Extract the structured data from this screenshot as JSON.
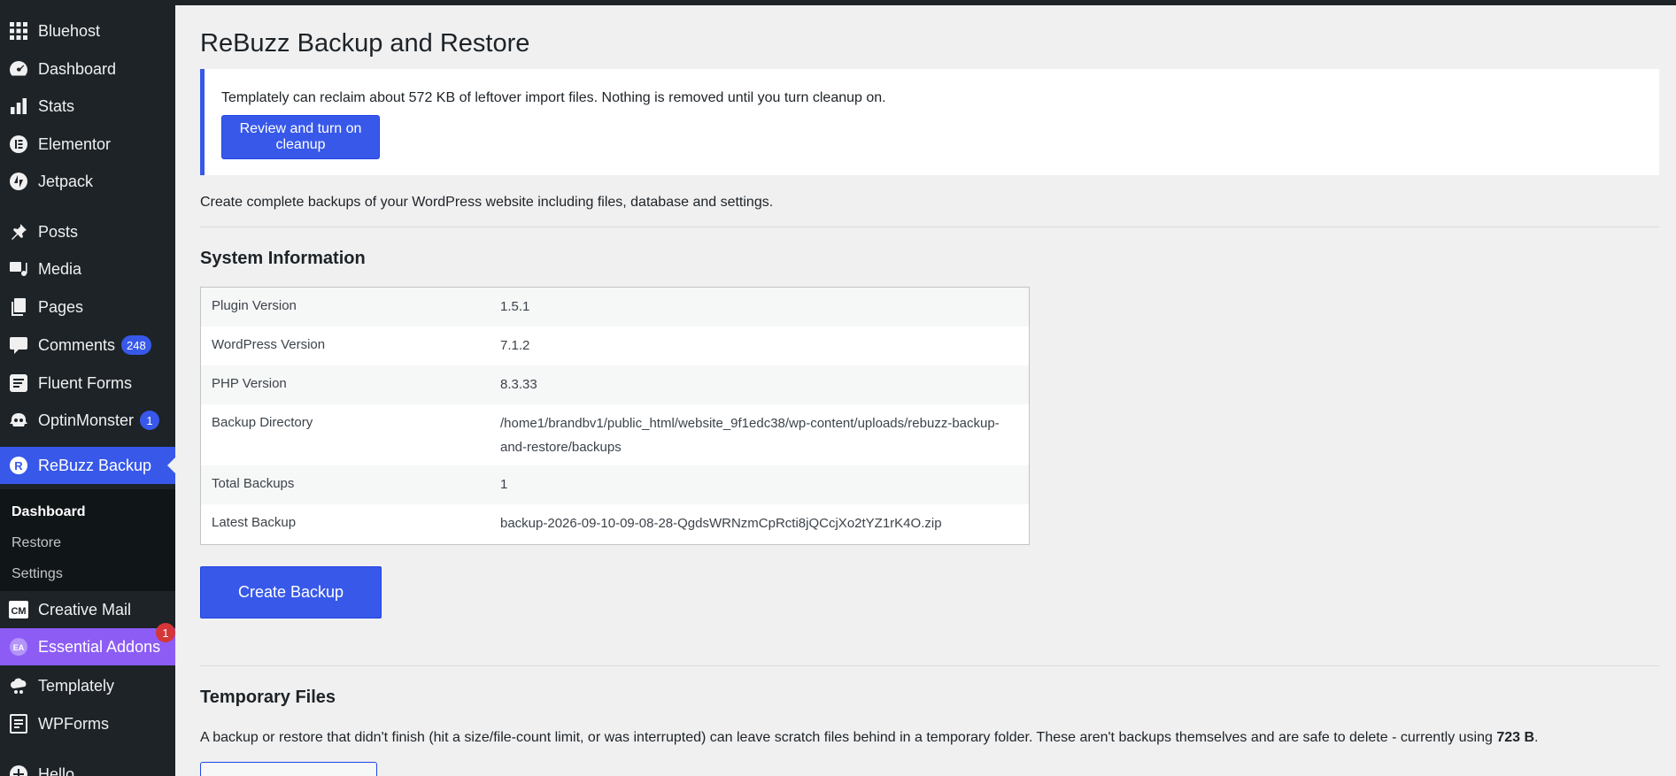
{
  "sidebar": {
    "items": [
      {
        "label": "Bluehost",
        "icon": "grid-icon"
      },
      {
        "label": "Dashboard",
        "icon": "dashboard-icon"
      },
      {
        "label": "Stats",
        "icon": "stats-icon"
      },
      {
        "label": "Elementor",
        "icon": "elementor-icon"
      },
      {
        "label": "Jetpack",
        "icon": "jetpack-icon"
      },
      {
        "label": "Posts",
        "icon": "pin-icon"
      },
      {
        "label": "Media",
        "icon": "media-icon"
      },
      {
        "label": "Pages",
        "icon": "pages-icon"
      },
      {
        "label": "Comments",
        "icon": "comment-icon",
        "badge": "248"
      },
      {
        "label": "Fluent Forms",
        "icon": "forms-icon"
      },
      {
        "label": "OptinMonster",
        "icon": "monster-icon",
        "badge": "1"
      },
      {
        "label": "ReBuzz Backup",
        "icon": "rebuzz-icon"
      },
      {
        "label": "Creative Mail",
        "icon": "cm-icon"
      },
      {
        "label": "Essential Addons",
        "icon": "ea-icon",
        "badge": "1"
      },
      {
        "label": "Templately",
        "icon": "templately-icon"
      },
      {
        "label": "WPForms",
        "icon": "wpforms-icon"
      },
      {
        "label": "Hello",
        "icon": "plus-icon"
      }
    ],
    "submenu": [
      "Dashboard",
      "Restore",
      "Settings"
    ],
    "cm_icon_text": "CM",
    "ea_icon_text": "EA"
  },
  "page": {
    "title": "ReBuzz Backup and Restore",
    "notice_text": "Templately can reclaim about 572 KB of leftover import files. Nothing is removed until you turn cleanup on.",
    "notice_button": "Review and turn on cleanup",
    "description": "Create complete backups of your WordPress website including files, database and settings.",
    "system_heading": "System Information",
    "system_rows": [
      {
        "key": "Plugin Version",
        "value": "1.5.1"
      },
      {
        "key": "WordPress Version",
        "value": "7.1.2"
      },
      {
        "key": "PHP Version",
        "value": "8.3.33"
      },
      {
        "key": "Backup Directory",
        "value": "/home1/brandbv1/public_html/website_9f1edc38/wp-content/uploads/rebuzz-backup-and-restore/backups"
      },
      {
        "key": "Total Backups",
        "value": "1"
      },
      {
        "key": "Latest Backup",
        "value": "backup-2026-09-10-09-08-28-QgdsWRNzmCpRcti8jQCcjXo2tYZ1rK4O.zip"
      }
    ],
    "create_button": "Create Backup",
    "temp_heading": "Temporary Files",
    "temp_text": "A backup or restore that didn't finish (hit a size/file-count limit, or was interrupted) can leave scratch files behind in a temporary folder. These aren't backups themselves and are safe to delete - currently using ",
    "temp_size": "723 B",
    "temp_end": "."
  },
  "colors": {
    "accent": "#3858e9",
    "sidebar": "#1d2327",
    "ea": "#8d5cf5",
    "badge_red": "#d63638"
  }
}
